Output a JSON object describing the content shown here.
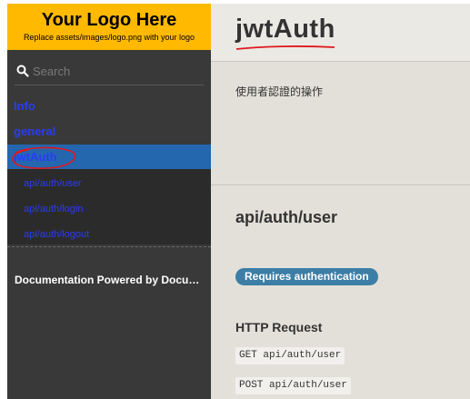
{
  "logo": {
    "title": "Your Logo Here",
    "subtitle": "Replace assets/images/logo.png with your logo"
  },
  "search": {
    "placeholder": "Search"
  },
  "toc": {
    "items": [
      {
        "label": "Info"
      },
      {
        "label": "general"
      },
      {
        "label": "jwtAuth",
        "active": true
      }
    ],
    "subitems": [
      {
        "label": "api/auth/user"
      },
      {
        "label": "api/auth/login"
      },
      {
        "label": "api/auth/logout"
      }
    ],
    "footer": "Documentation Powered by Documentarian"
  },
  "main": {
    "title": "jwtAuth",
    "description": "使用者認證的操作",
    "endpoint_title": "api/auth/user",
    "badge": "Requires authentication",
    "http_heading": "HTTP Request",
    "requests": [
      "GET api/auth/user",
      "POST api/auth/user"
    ]
  },
  "colors": {
    "logo_bg": "#ffb900",
    "sidebar_bg": "#393939",
    "active_bg": "#2467af",
    "link": "#2a3cf5",
    "badge_bg": "#3c7ea6",
    "annotation": "#e0191e"
  }
}
